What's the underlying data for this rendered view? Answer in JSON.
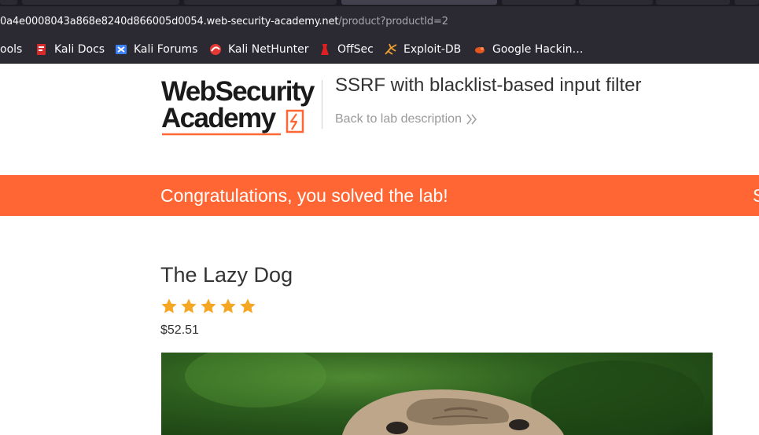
{
  "browser": {
    "url": {
      "host": "0a4e0008043a868e8240d866005d0054.web-security-academy.net",
      "path": "/product?productId=2"
    },
    "bookmarks": [
      {
        "label": "ools",
        "icon": "tools-icon"
      },
      {
        "label": "Kali Docs",
        "icon": "kali-docs-icon"
      },
      {
        "label": "Kali Forums",
        "icon": "kali-forums-icon"
      },
      {
        "label": "Kali NetHunter",
        "icon": "kali-nethunter-icon"
      },
      {
        "label": "OffSec",
        "icon": "offsec-icon"
      },
      {
        "label": "Exploit-DB",
        "icon": "exploit-db-icon"
      },
      {
        "label": "Google Hackin…",
        "icon": "google-hacking-icon"
      }
    ]
  },
  "header": {
    "logo_line1": "WebSecurity",
    "logo_line2": "Academy",
    "lab_title": "SSRF with blacklist-based input filter",
    "back_link": "Back to lab description"
  },
  "banner": {
    "message": "Congratulations, you solved the lab!",
    "trailing_text": "S",
    "color": "#ff6633"
  },
  "product": {
    "name": "The Lazy Dog",
    "rating": 5,
    "rating_max": 5,
    "price": "$52.51",
    "image_icon": "product-photo-pug"
  },
  "colors": {
    "accent": "#ff6633",
    "star": "#f5a623",
    "chrome": "#2b2a33"
  }
}
